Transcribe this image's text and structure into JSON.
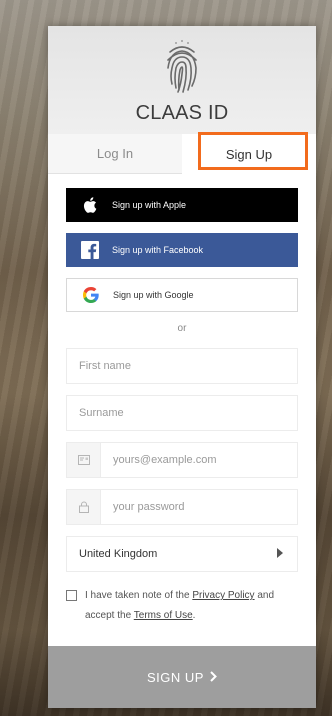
{
  "brand": {
    "title": "CLAAS ID",
    "logo_icon": "fingerprint-icon"
  },
  "tabs": [
    {
      "label": "Log In",
      "active": false
    },
    {
      "label": "Sign Up",
      "active": true
    }
  ],
  "social": {
    "apple": {
      "label": "Sign up with Apple",
      "icon": "apple-icon"
    },
    "facebook": {
      "label": "Sign up with Facebook",
      "icon": "facebook-icon"
    },
    "google": {
      "label": "Sign up with Google",
      "icon": "google-icon"
    }
  },
  "separator": "or",
  "fields": {
    "first_name": {
      "placeholder": "First name",
      "value": ""
    },
    "surname": {
      "placeholder": "Surname",
      "value": ""
    },
    "email": {
      "placeholder": "yours@example.com",
      "value": "",
      "icon": "email-icon"
    },
    "password": {
      "placeholder": "your password",
      "value": "",
      "icon": "lock-icon"
    }
  },
  "country": {
    "selected": "United Kingdom",
    "icon": "caret-right-icon"
  },
  "consent": {
    "text_1": "I have taken note of the",
    "privacy_link": "Privacy Policy",
    "text_2": "and accept the",
    "terms_link": "Terms of Use",
    "text_3": ".",
    "checked": false
  },
  "submit": {
    "label": "SIGN UP",
    "icon": "chevron-right-icon"
  },
  "colors": {
    "highlight": "#f26b1d",
    "facebook": "#3b5998",
    "apple": "#000000",
    "submit": "#9e9e9e"
  }
}
